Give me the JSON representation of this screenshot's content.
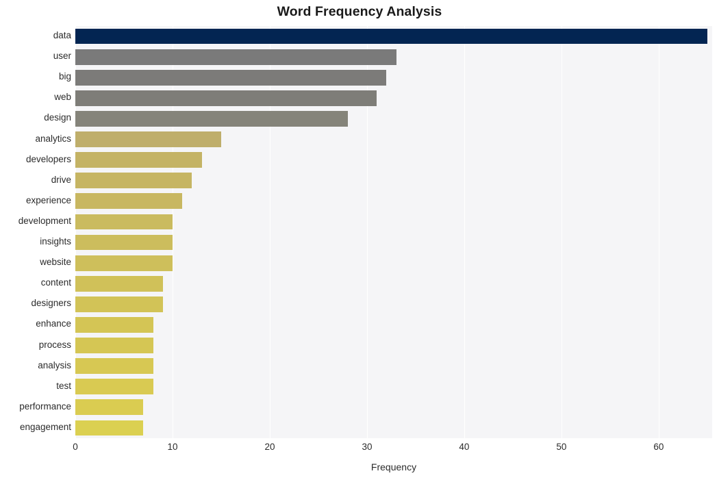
{
  "chart_data": {
    "type": "bar",
    "orientation": "horizontal",
    "title": "Word Frequency Analysis",
    "xlabel": "Frequency",
    "ylabel": "",
    "xlim": [
      0,
      65.5
    ],
    "xticks": [
      0,
      10,
      20,
      30,
      40,
      50,
      60
    ],
    "xtick_labels": [
      "0",
      "10",
      "20",
      "30",
      "40",
      "50",
      "60"
    ],
    "grid": "vertical-white-on-light",
    "legend": "none",
    "categories": [
      "data",
      "user",
      "big",
      "web",
      "design",
      "analytics",
      "developers",
      "drive",
      "experience",
      "development",
      "insights",
      "website",
      "content",
      "designers",
      "enhance",
      "process",
      "analysis",
      "test",
      "performance",
      "engagement"
    ],
    "values": [
      65,
      33,
      32,
      31,
      28,
      15,
      13,
      12,
      11,
      10,
      10,
      10,
      9,
      9,
      8,
      8,
      8,
      8,
      7,
      7
    ],
    "bar_colors": [
      "#032552",
      "#7a7a7a",
      "#7c7b79",
      "#7e7d78",
      "#85847a",
      "#bfae6b",
      "#c4b365",
      "#c6b563",
      "#c8b761",
      "#cabb5f",
      "#ccbd5d",
      "#cebf5b",
      "#d0c159",
      "#d2c357",
      "#d4c555",
      "#d5c654",
      "#d7c853",
      "#d9ca52",
      "#dacc51",
      "#dbd051"
    ],
    "plot_background": "#f5f5f7",
    "gridline_color": "#ffffff",
    "figure_background": "#ffffff"
  },
  "axes": {
    "x_axis_title": "Frequency"
  }
}
